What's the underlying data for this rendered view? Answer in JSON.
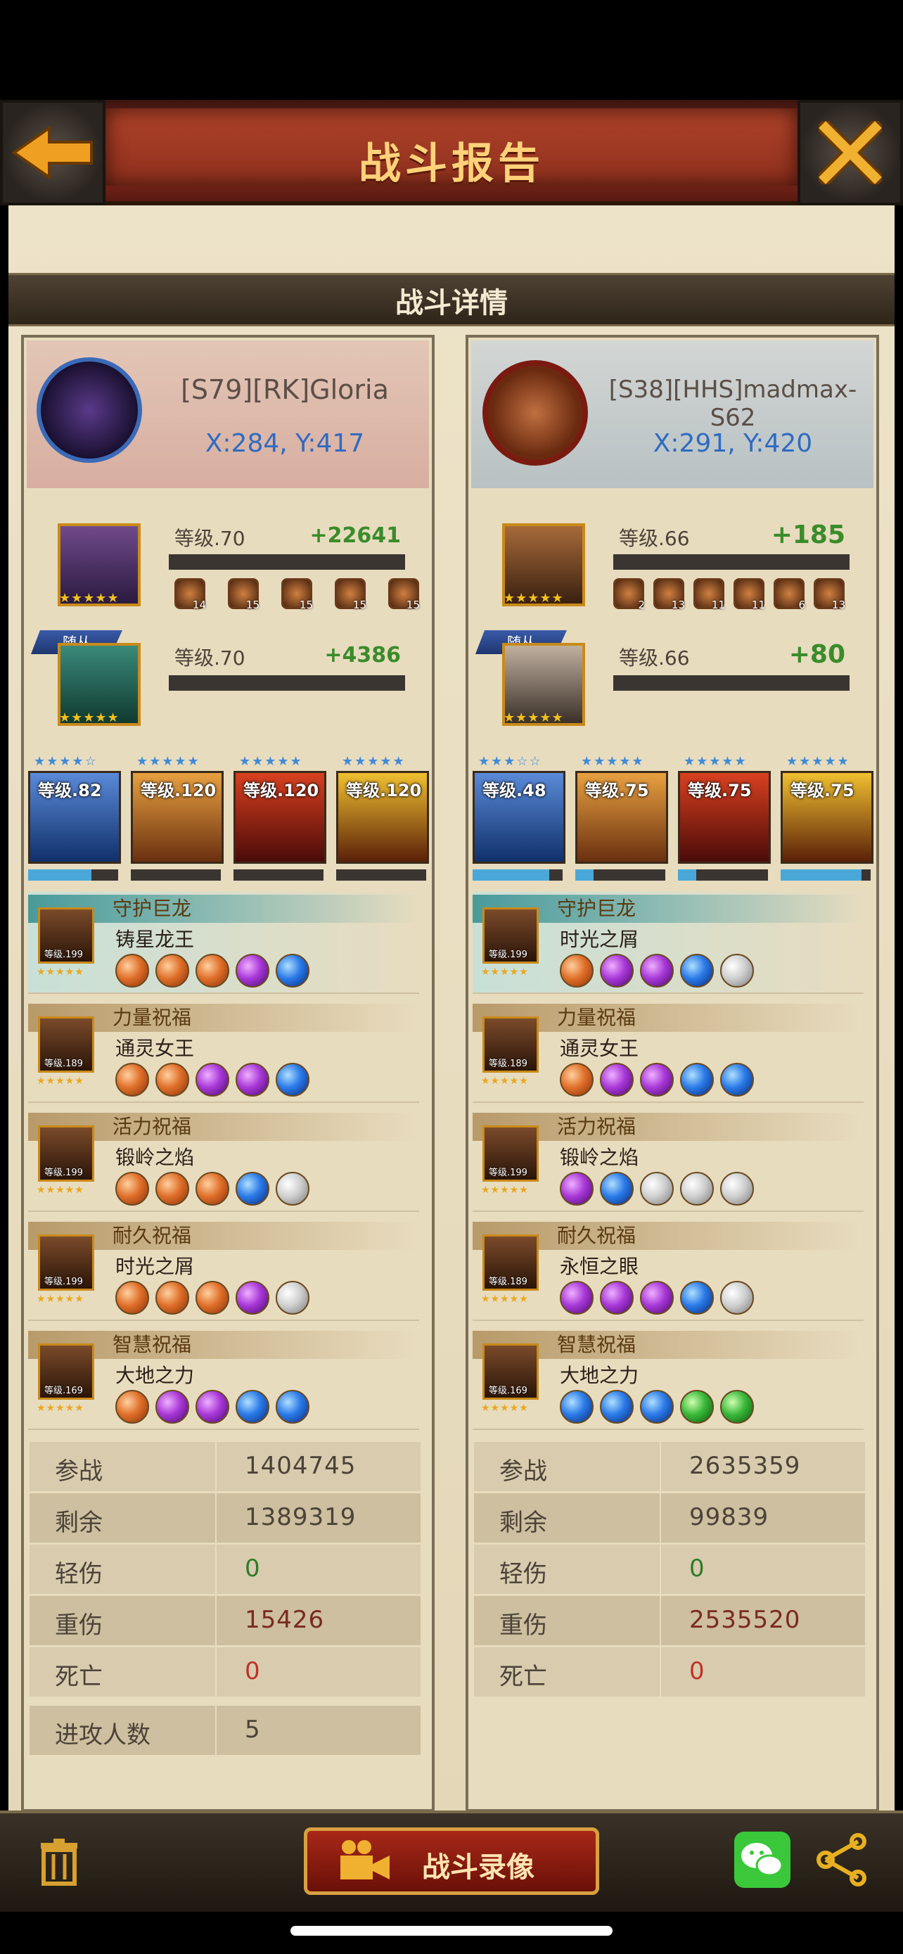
{
  "header": {
    "title": "战斗报告",
    "back_icon": "arrow-left-icon",
    "close_icon": "close-icon"
  },
  "section_title": "战斗详情",
  "players": [
    {
      "name": "[S79][RK]Gloria",
      "coords": "X:284, Y:417",
      "hero": {
        "level": "等级.70",
        "gain": "+22641",
        "equipment": [
          "14",
          "15",
          "15",
          "15",
          "15"
        ]
      },
      "follower": {
        "badge": "随从",
        "level": "等级.70",
        "gain": "+4386"
      },
      "troops": [
        {
          "level": "等级.82",
          "stars": 4,
          "exp_fraction": 0.7
        },
        {
          "level": "等级.120",
          "stars": 5,
          "exp_fraction": 0.0
        },
        {
          "level": "等级.120",
          "stars": 5,
          "exp_fraction": 0.0
        },
        {
          "level": "等级.120",
          "stars": 5,
          "exp_fraction": 0.0
        }
      ],
      "dragons": [
        {
          "type": "守护巨龙",
          "name": "铸星龙王",
          "level": "等级.199",
          "gems": [
            "orange",
            "orange",
            "orange",
            "purple",
            "blue"
          ]
        },
        {
          "type": "力量祝福",
          "name": "通灵女王",
          "level": "等级.189",
          "gems": [
            "orange",
            "orange",
            "purple",
            "purple",
            "blue"
          ]
        },
        {
          "type": "活力祝福",
          "name": "锻岭之焰",
          "level": "等级.199",
          "gems": [
            "orange",
            "orange",
            "orange",
            "blue",
            "white"
          ]
        },
        {
          "type": "耐久祝福",
          "name": "时光之屑",
          "level": "等级.199",
          "gems": [
            "orange",
            "orange",
            "orange",
            "purple",
            "white"
          ]
        },
        {
          "type": "智慧祝福",
          "name": "大地之力",
          "level": "等级.169",
          "gems": [
            "orange",
            "purple",
            "purple",
            "blue",
            "blue"
          ]
        }
      ],
      "stats": [
        {
          "label": "参战",
          "value": "1404745",
          "color": "#4c4238"
        },
        {
          "label": "剩余",
          "value": "1389319",
          "color": "#4c4238"
        },
        {
          "label": "轻伤",
          "value": "0",
          "color": "#2f7a2a"
        },
        {
          "label": "重伤",
          "value": "15426",
          "color": "#7a2a20"
        },
        {
          "label": "死亡",
          "value": "0",
          "color": "#c0302a"
        }
      ],
      "attackers": {
        "label": "进攻人数",
        "value": "5"
      }
    },
    {
      "name": "[S38][HHS]madmax-S62",
      "coords": "X:291, Y:420",
      "hero": {
        "level": "等级.66",
        "gain": "+185",
        "equipment": [
          "2",
          "13",
          "11",
          "11",
          "6",
          "13"
        ]
      },
      "follower": {
        "badge": "随从",
        "level": "等级.66",
        "gain": "+80"
      },
      "troops": [
        {
          "level": "等级.48",
          "stars": 3,
          "exp_fraction": 0.85
        },
        {
          "level": "等级.75",
          "stars": 5,
          "exp_fraction": 0.2
        },
        {
          "level": "等级.75",
          "stars": 5,
          "exp_fraction": 0.2
        },
        {
          "level": "等级.75",
          "stars": 5,
          "exp_fraction": 0.9
        }
      ],
      "dragons": [
        {
          "type": "守护巨龙",
          "name": "时光之屑",
          "level": "等级.199",
          "gems": [
            "orange",
            "purple",
            "purple",
            "blue",
            "white"
          ]
        },
        {
          "type": "力量祝福",
          "name": "通灵女王",
          "level": "等级.189",
          "gems": [
            "orange",
            "purple",
            "purple",
            "blue",
            "blue"
          ]
        },
        {
          "type": "活力祝福",
          "name": "锻岭之焰",
          "level": "等级.199",
          "gems": [
            "purple",
            "blue",
            "white",
            "white",
            "white"
          ]
        },
        {
          "type": "耐久祝福",
          "name": "永恒之眼",
          "level": "等级.189",
          "gems": [
            "purple",
            "purple",
            "purple",
            "blue",
            "white"
          ]
        },
        {
          "type": "智慧祝福",
          "name": "大地之力",
          "level": "等级.169",
          "gems": [
            "blue",
            "blue",
            "blue",
            "green",
            "green"
          ]
        }
      ],
      "stats": [
        {
          "label": "参战",
          "value": "2635359",
          "color": "#4c4238"
        },
        {
          "label": "剩余",
          "value": "99839",
          "color": "#4c4238"
        },
        {
          "label": "轻伤",
          "value": "0",
          "color": "#2f7a2a"
        },
        {
          "label": "重伤",
          "value": "2535520",
          "color": "#7a2a20"
        },
        {
          "label": "死亡",
          "value": "0",
          "color": "#c0302a"
        }
      ]
    }
  ],
  "footer": {
    "record_label": "战斗录像",
    "trash_icon": "trash-icon",
    "camera_icon": "video-camera-icon",
    "wechat_icon": "wechat-icon",
    "share_icon": "share-icon"
  }
}
